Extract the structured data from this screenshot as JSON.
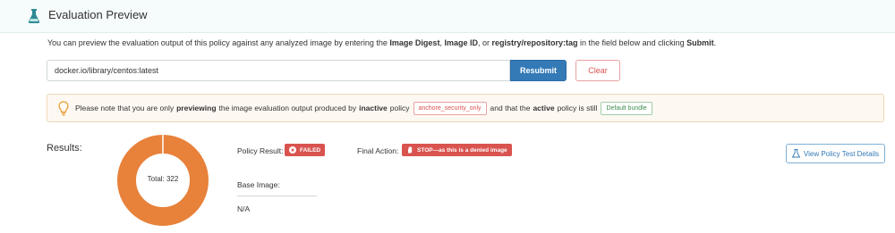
{
  "header": {
    "title": "Evaluation Preview",
    "icon": "flask-icon"
  },
  "intro": {
    "part1": "You can preview the evaluation output of this policy against any analyzed image by entering the ",
    "bold1": "Image Digest",
    "sep1": ", ",
    "bold2": "Image ID",
    "sep2": ", or ",
    "bold3": "registry/repository:tag",
    "part2": " in the field below and clicking ",
    "bold4": "Submit",
    "end": "."
  },
  "search": {
    "value": "docker.io/library/centos:latest",
    "resubmit_label": "Resubmit",
    "clear_label": "Clear"
  },
  "notice": {
    "icon": "lightbulb-icon",
    "t1": "Please note that you are only",
    "b1": "previewing",
    "t2": "the image evaluation output produced by",
    "b2": "inactive",
    "t3": "policy",
    "policy_tag": "anchore_security_only",
    "t4": "and that the",
    "b3": "active",
    "t5": "policy is still",
    "bundle_tag": "Default bundle"
  },
  "results": {
    "label": "Results:",
    "total_text": "Total: 322",
    "donut_color": "#e8813a",
    "policy_result_label": "Policy Result:",
    "policy_result_value": "FAILED",
    "final_action_label": "Final Action:",
    "final_action_value": "STOP—as this is a denied image",
    "base_image_label": "Base Image:",
    "base_image_value": "N/A",
    "view_button_label": "View Policy Test Details"
  },
  "colors": {
    "primary": "#337ab7",
    "danger": "#d9534f",
    "success": "#3c8d4f",
    "warning": "#e8813a"
  }
}
